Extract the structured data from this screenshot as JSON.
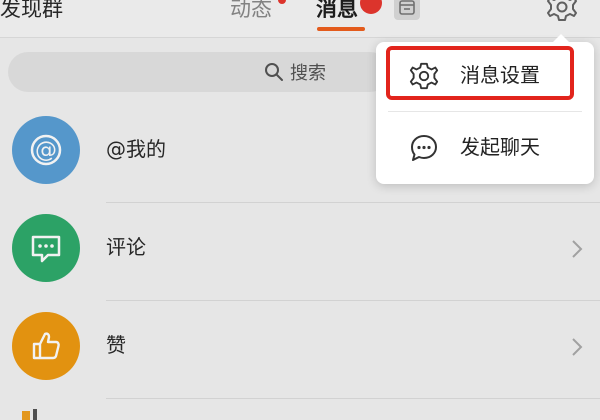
{
  "header": {
    "left_title": "发现群",
    "tabs": [
      {
        "label": "动态"
      },
      {
        "label": "消息"
      }
    ]
  },
  "search": {
    "label": "搜索"
  },
  "list": {
    "items": [
      {
        "label": "@我的",
        "avatar_color": "#5aa0d6",
        "icon": "at-icon"
      },
      {
        "label": "评论",
        "avatar_color": "#2fab6c",
        "icon": "comment-icon"
      },
      {
        "label": "赞",
        "avatar_color": "#ef9a11",
        "icon": "thumbs-up-icon"
      }
    ]
  },
  "popup": {
    "items": [
      {
        "label": "消息设置",
        "icon": "gear-icon"
      },
      {
        "label": "发起聊天",
        "icon": "chat-bubble-icon"
      }
    ]
  },
  "colors": {
    "accent": "#f0601e",
    "badge": "#e8372f",
    "highlight": "#e2241c"
  }
}
